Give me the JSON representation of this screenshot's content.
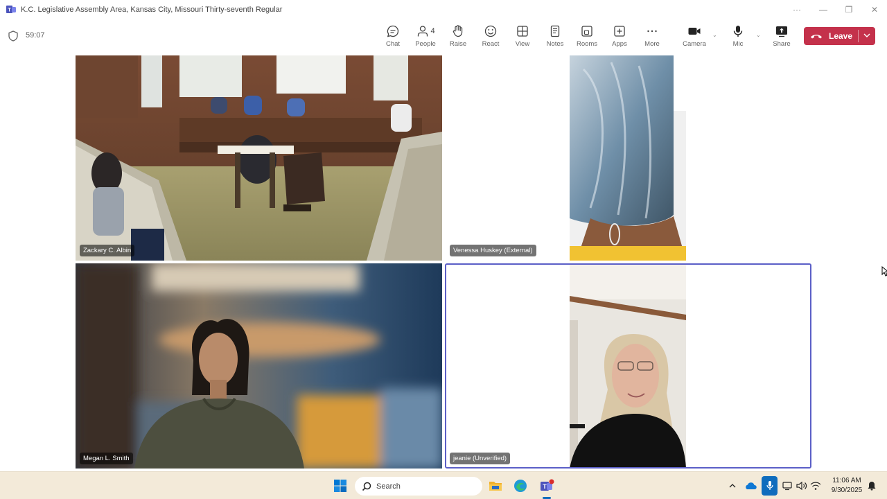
{
  "window": {
    "title": "K.C. Legislative Assembly Area, Kansas City, Missouri Thirty-seventh Regular",
    "controls": {
      "more": "···",
      "minimize": "—",
      "restore": "❐",
      "close": "✕"
    }
  },
  "meeting": {
    "timer": "59:07"
  },
  "toolbar": {
    "chat": "Chat",
    "people": "People",
    "people_count": "4",
    "raise": "Raise",
    "react": "React",
    "view": "View",
    "notes": "Notes",
    "rooms": "Rooms",
    "apps": "Apps",
    "more": "More",
    "camera": "Camera",
    "mic": "Mic",
    "share": "Share",
    "leave": "Leave"
  },
  "participants": [
    {
      "name": "Zackary C. Albin"
    },
    {
      "name": "Venessa Huskey (External)"
    },
    {
      "name": "Megan L. Smith"
    },
    {
      "name": "jeanie (Unverified)"
    }
  ],
  "taskbar": {
    "search_placeholder": "Search",
    "time": "11:06 AM",
    "date": "9/30/2025"
  },
  "colors": {
    "leave_button": "#c4314b",
    "active_speaker_border": "#5b5fc7",
    "taskbar_bg": "#f3ead9",
    "accent": "#0f6cbd"
  },
  "icons": [
    "teams-logo-icon",
    "shield-icon",
    "chat-icon",
    "people-icon",
    "raise-hand-icon",
    "react-icon",
    "view-icon",
    "notes-icon",
    "rooms-icon",
    "apps-icon",
    "more-icon",
    "camera-icon",
    "mic-icon",
    "share-icon",
    "phone-icon",
    "windows-start-icon",
    "search-icon",
    "file-explorer-icon",
    "edge-icon",
    "teams-taskbar-icon",
    "chevron-up-icon",
    "onedrive-icon",
    "mic-active-icon",
    "display-icon",
    "volume-icon",
    "network-icon",
    "notification-icon",
    "cursor-icon"
  ]
}
